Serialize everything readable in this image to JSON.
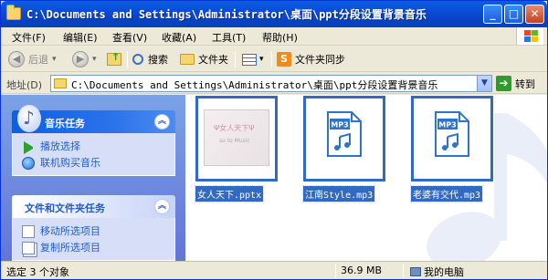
{
  "window": {
    "title": "C:\\Documents and Settings\\Administrator\\桌面\\ppt分段设置背景音乐",
    "minimize_glyph": "_",
    "maximize_glyph": "□",
    "close_glyph": "✕"
  },
  "menu": {
    "items": [
      "文件(F)",
      "编辑(E)",
      "查看(V)",
      "收藏(A)",
      "工具(T)",
      "帮助(H)"
    ]
  },
  "toolbar": {
    "back_label": "后退",
    "back_glyph": "◀",
    "forward_glyph": "▶",
    "dropdown_glyph": "▾",
    "search_label": "搜索",
    "folders_label": "文件夹",
    "sync_label": "文件夹同步",
    "sync_badge": "S",
    "view_dropdown_glyph": "▾"
  },
  "address": {
    "label": "地址(D)",
    "value": "C:\\Documents and Settings\\Administrator\\桌面\\ppt分段设置背景音乐",
    "dropdown_glyph": "▼",
    "go_label": "转到",
    "go_glyph": "➔"
  },
  "tasks": {
    "music": {
      "title": "音乐任务",
      "icon": "♪",
      "collapse_glyph": "︽",
      "items": [
        "播放选择",
        "联机购买音乐"
      ]
    },
    "file": {
      "title": "文件和文件夹任务",
      "collapse_glyph": "︽",
      "items": [
        "移动所选项目",
        "复制所选项目"
      ]
    }
  },
  "files": [
    {
      "name": "女人天下.pptx",
      "type": "pptx",
      "preview_title": "Ψ女人天下Ψ",
      "preview_sub": "so to Music"
    },
    {
      "name": "江南Style.mp3",
      "type": "mp3",
      "badge": "MP3"
    },
    {
      "name": "老婆有交代.mp3",
      "type": "mp3",
      "badge": "MP3"
    }
  ],
  "status": {
    "selection": "选定 3 个对象",
    "size": "36.9 MB",
    "location": "我的电脑"
  },
  "colors": {
    "titlebar": "#0a4bd6",
    "selection": "#316ac5",
    "taskpane": "#6375d6",
    "go_green": "#2d9b2d"
  }
}
